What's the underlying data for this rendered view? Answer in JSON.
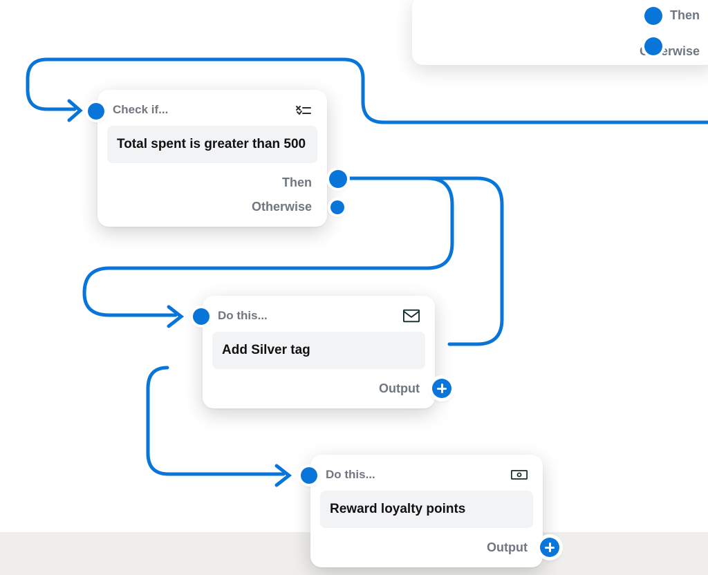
{
  "colors": {
    "connector": "#0a75d8",
    "muted": "#6e7781"
  },
  "ghostcard": {
    "then_label": "Then",
    "otherwise_label": "Otherwise"
  },
  "card1": {
    "header": "Check if...",
    "condition": "Total spent is greater than 500",
    "then_label": "Then",
    "otherwise_label": "Otherwise",
    "icon": "condition-icon"
  },
  "card2": {
    "header": "Do this...",
    "action": "Add Silver tag",
    "output_label": "Output",
    "icon": "mail-icon"
  },
  "card3": {
    "header": "Do this...",
    "action": "Reward loyalty points",
    "output_label": "Output",
    "icon": "payment-icon"
  }
}
